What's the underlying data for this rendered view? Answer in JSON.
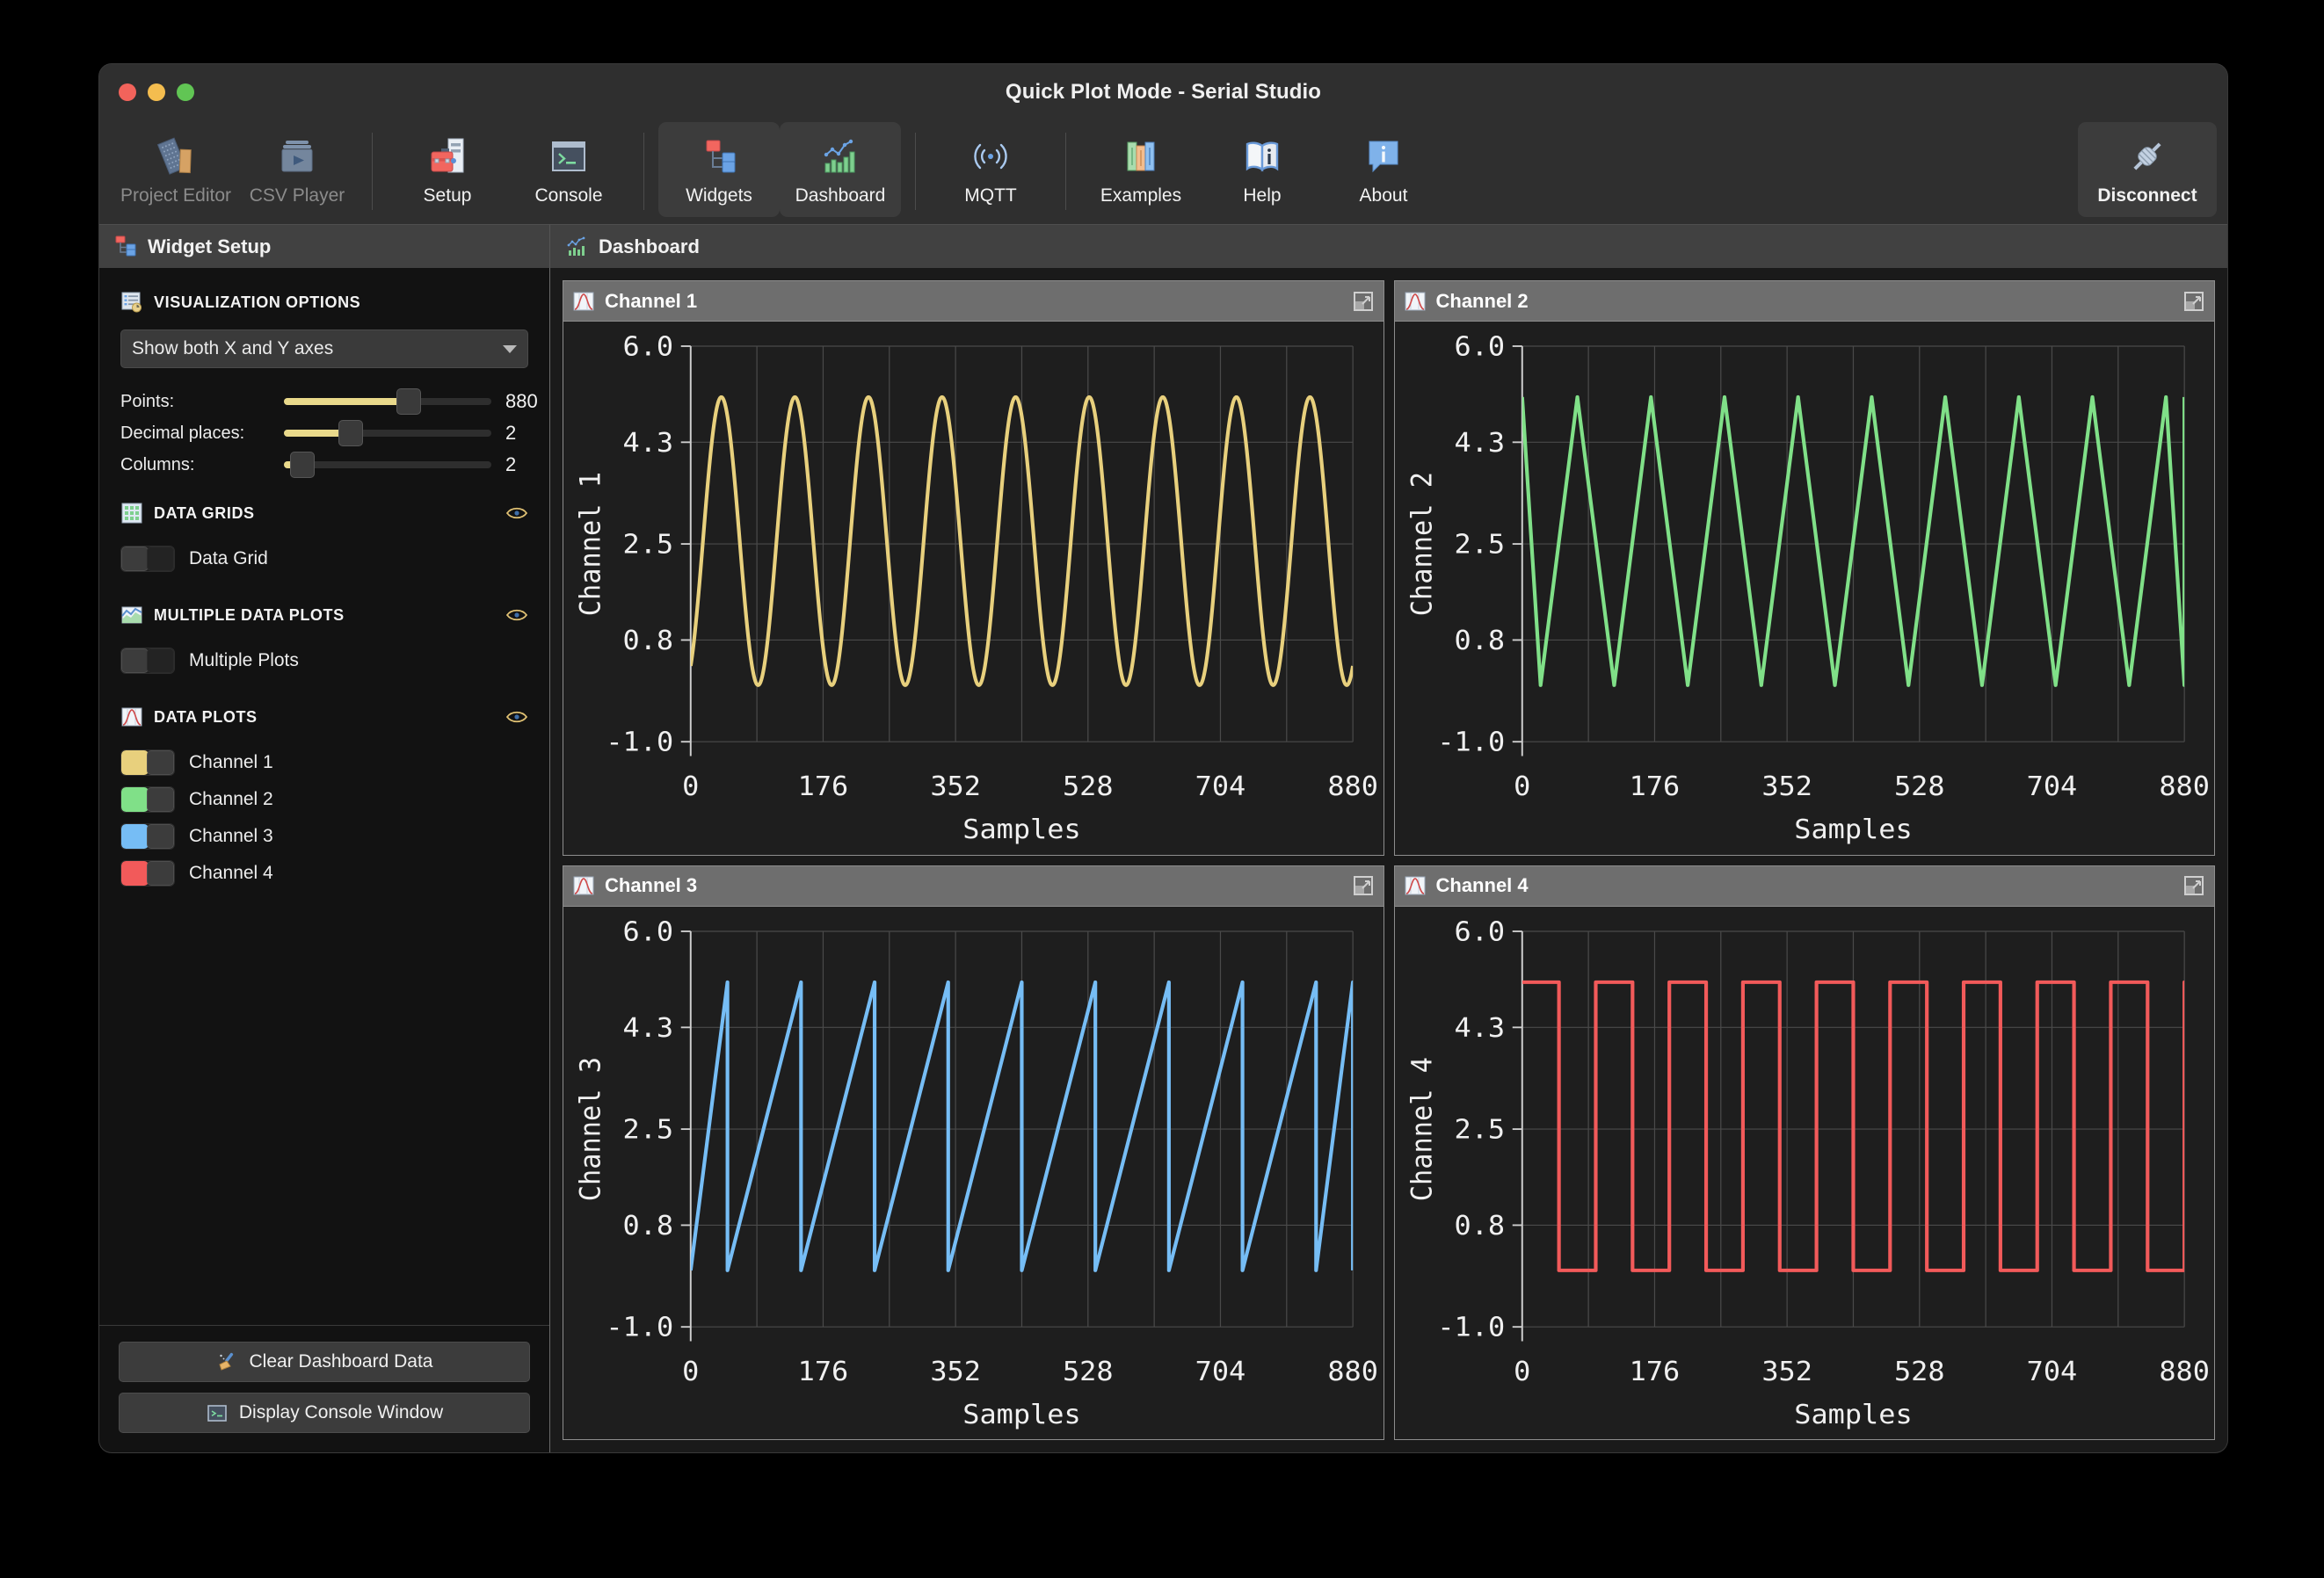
{
  "window": {
    "title": "Quick Plot Mode - Serial Studio",
    "traffic": [
      "close-button",
      "minimize-button",
      "maximize-button"
    ]
  },
  "toolbar": {
    "items": [
      {
        "label": "Project Editor",
        "icon": "ruler-document-icon",
        "state": "disabled"
      },
      {
        "label": "CSV Player",
        "icon": "media-play-icon",
        "state": "disabled"
      },
      {
        "label": "Setup",
        "icon": "toolbox-server-icon",
        "state": "normal"
      },
      {
        "label": "Console",
        "icon": "terminal-icon",
        "state": "normal"
      },
      {
        "label": "Widgets",
        "icon": "widget-tree-icon",
        "state": "active"
      },
      {
        "label": "Dashboard",
        "icon": "chart-bars-line-icon",
        "state": "active"
      },
      {
        "label": "MQTT",
        "icon": "broadcast-icon",
        "state": "normal"
      },
      {
        "label": "Examples",
        "icon": "books-icon",
        "state": "normal"
      },
      {
        "label": "Help",
        "icon": "open-book-info-icon",
        "state": "normal"
      },
      {
        "label": "About",
        "icon": "info-bubble-icon",
        "state": "normal"
      }
    ],
    "disconnect": {
      "label": "Disconnect",
      "icon": "connector-plug-icon"
    }
  },
  "panels": {
    "left_title": "Widget Setup",
    "left_icon": "widget-tree-icon",
    "right_title": "Dashboard",
    "right_icon": "chart-bars-line-icon"
  },
  "sidebar": {
    "visualization": {
      "title": "VISUALIZATION OPTIONS",
      "icon": "options-list-icon",
      "axis_mode": "Show both X and Y axes",
      "axis_mode_options": [
        "Show both X and Y axes"
      ],
      "sliders": [
        {
          "label": "Points:",
          "value": "880",
          "percent": 60
        },
        {
          "label": "Decimal places:",
          "value": "2",
          "percent": 32
        },
        {
          "label": "Columns:",
          "value": "2",
          "percent": 9
        }
      ]
    },
    "data_grids": {
      "title": "DATA GRIDS",
      "icon": "grid-table-icon",
      "eye_icon": "eye-icon",
      "items": [
        {
          "label": "Data Grid",
          "on": false,
          "color": "#3c3c3c"
        }
      ]
    },
    "multiple_plots": {
      "title": "MULTIPLE DATA PLOTS",
      "icon": "multi-plot-icon",
      "eye_icon": "eye-icon",
      "items": [
        {
          "label": "Multiple Plots",
          "on": false,
          "color": "#3c3c3c"
        }
      ]
    },
    "data_plots": {
      "title": "DATA PLOTS",
      "icon": "plot-curve-icon",
      "eye_icon": "eye-icon",
      "items": [
        {
          "label": "Channel 1",
          "on": true,
          "color": "#e8d07d"
        },
        {
          "label": "Channel 2",
          "on": true,
          "color": "#80e088"
        },
        {
          "label": "Channel 3",
          "on": true,
          "color": "#76bdf5"
        },
        {
          "label": "Channel 4",
          "on": true,
          "color": "#f25a5a"
        }
      ]
    },
    "buttons": [
      {
        "label": "Clear Dashboard Data",
        "icon": "broom-icon"
      },
      {
        "label": "Display Console Window",
        "icon": "terminal-icon"
      }
    ]
  },
  "chart_data": [
    {
      "type": "line",
      "title": "Channel 1",
      "waveform": "sine",
      "cycles": 9,
      "phase_deg": 60,
      "color": "#e8d07d",
      "xlabel": "Samples",
      "ylabel": "Channel 1",
      "xticks": [
        "0",
        "176",
        "352",
        "528",
        "704",
        "880"
      ],
      "xtick_values": [
        0,
        176,
        352,
        528,
        704,
        880
      ],
      "yticks": [
        "6.0",
        "4.3",
        "2.5",
        "0.8",
        "-1.0"
      ],
      "ytick_values": [
        6.0,
        4.3,
        2.5,
        0.8,
        -1.0
      ],
      "xlim": [
        0,
        880
      ],
      "ylim": [
        -1.0,
        6.0
      ],
      "amplitude_high": 5.1,
      "amplitude_low": 0.0,
      "grid": true,
      "expand_icon": "expand-icon"
    },
    {
      "type": "line",
      "title": "Channel 2",
      "waveform": "triangle",
      "cycles": 9,
      "phase_deg": 90,
      "color": "#80e088",
      "xlabel": "Samples",
      "ylabel": "Channel 2",
      "xticks": [
        "0",
        "176",
        "352",
        "528",
        "704",
        "880"
      ],
      "xtick_values": [
        0,
        176,
        352,
        528,
        704,
        880
      ],
      "yticks": [
        "6.0",
        "4.3",
        "2.5",
        "0.8",
        "-1.0"
      ],
      "ytick_values": [
        6.0,
        4.3,
        2.5,
        0.8,
        -1.0
      ],
      "xlim": [
        0,
        880
      ],
      "ylim": [
        -1.0,
        6.0
      ],
      "amplitude_high": 5.1,
      "amplitude_low": 0.0,
      "grid": true,
      "expand_icon": "expand-icon"
    },
    {
      "type": "line",
      "title": "Channel 3",
      "waveform": "sawtooth",
      "cycles": 9,
      "phase_deg": 180,
      "color": "#76bdf5",
      "xlabel": "Samples",
      "ylabel": "Channel 3",
      "xticks": [
        "0",
        "176",
        "352",
        "528",
        "704",
        "880"
      ],
      "xtick_values": [
        0,
        176,
        352,
        528,
        704,
        880
      ],
      "yticks": [
        "6.0",
        "4.3",
        "2.5",
        "0.8",
        "-1.0"
      ],
      "ytick_values": [
        6.0,
        4.3,
        2.5,
        0.8,
        -1.0
      ],
      "xlim": [
        0,
        880
      ],
      "ylim": [
        -1.0,
        6.0
      ],
      "amplitude_high": 5.1,
      "amplitude_low": 0.0,
      "grid": true,
      "expand_icon": "expand-icon"
    },
    {
      "type": "line",
      "title": "Channel 4",
      "waveform": "square",
      "cycles": 9,
      "phase_deg": 0,
      "color": "#f25a5a",
      "xlabel": "Samples",
      "ylabel": "Channel 4",
      "xticks": [
        "0",
        "176",
        "352",
        "528",
        "704",
        "880"
      ],
      "xtick_values": [
        0,
        176,
        352,
        528,
        704,
        880
      ],
      "yticks": [
        "6.0",
        "4.3",
        "2.5",
        "0.8",
        "-1.0"
      ],
      "ytick_values": [
        6.0,
        4.3,
        2.5,
        0.8,
        -1.0
      ],
      "xlim": [
        0,
        880
      ],
      "ylim": [
        -1.0,
        6.0
      ],
      "amplitude_high": 5.1,
      "amplitude_low": 0.0,
      "grid": true,
      "expand_icon": "expand-icon"
    }
  ]
}
